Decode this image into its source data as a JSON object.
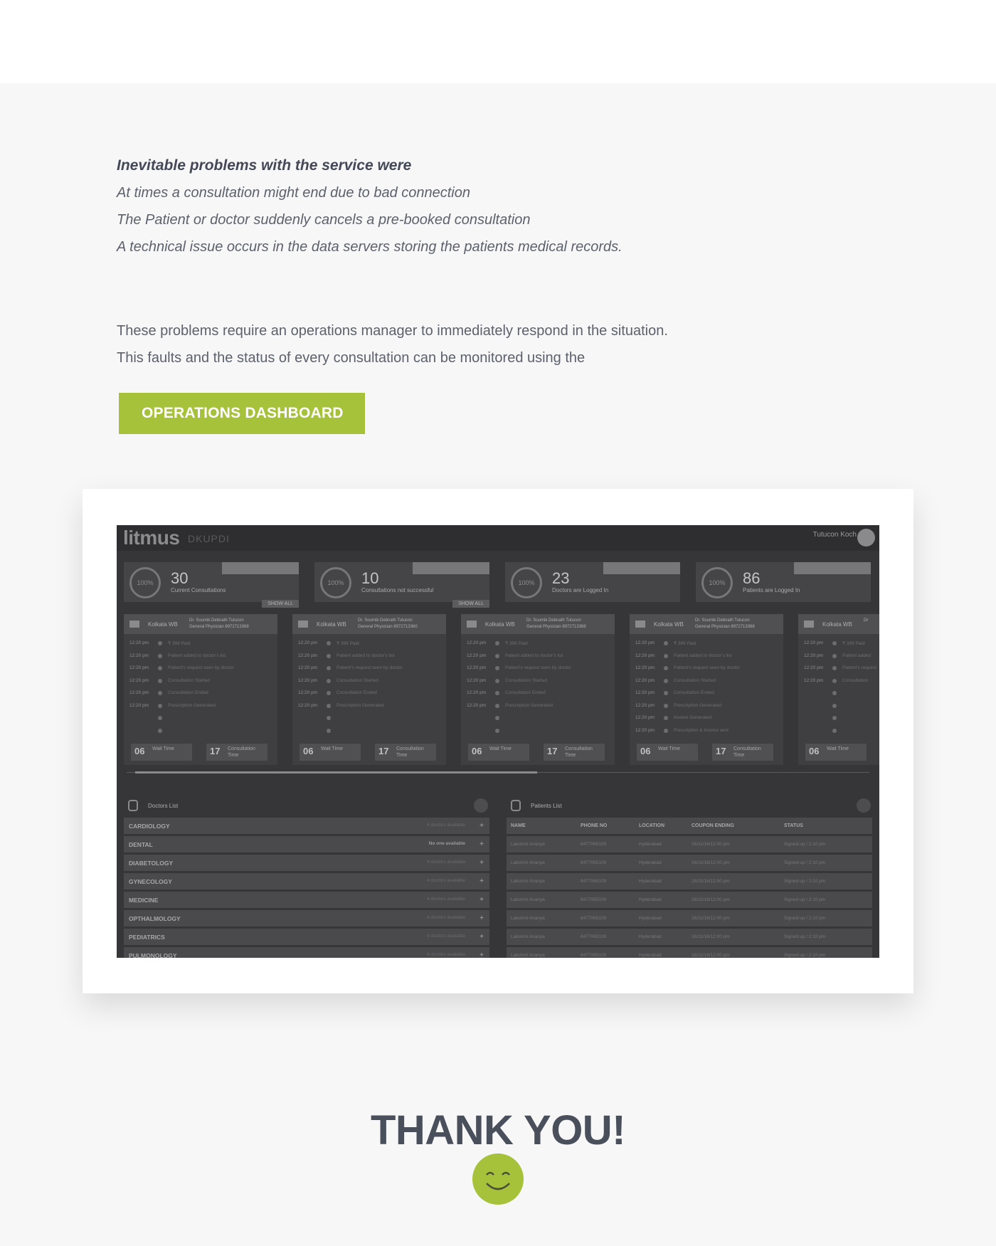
{
  "problems": {
    "heading": "Inevitable problems with the service were",
    "items": [
      "At times a consultation might end due to bad connection",
      "The Patient or doctor suddenly cancels a pre-booked consultation",
      "A technical issue occurs in the data servers storing the patients medical records."
    ]
  },
  "paragraph": [
    "These problems require an operations manager to immediately respond in the situation.",
    "This faults and the status of every consultation can be monitored using the"
  ],
  "cta_label": "OPERATIONS DASHBOARD",
  "dashboard": {
    "logo": "litmus",
    "logo_sub": "DKUPDI",
    "user": "Tutucon Koch",
    "stats": [
      {
        "ring": "100%",
        "value": "30",
        "label": "Current Consultations",
        "show_all": "SHOW ALL"
      },
      {
        "ring": "100%",
        "value": "10",
        "label": "Consultations not successful",
        "show_all": "SHOW ALL"
      },
      {
        "ring": "100%",
        "value": "23",
        "label": "Doctors are Logged In"
      },
      {
        "ring": "100%",
        "value": "86",
        "label": "Patients are Logged In"
      }
    ],
    "columns": [
      {
        "city": "Kolkata WB",
        "doc": "Dr. Soumik Debnath  Tutucon",
        "spec": "General Physician  8972713368",
        "wait": "06",
        "wait_label": "Wait Time",
        "consult": "17",
        "consult_label": "Consultation Time",
        "events": [
          "₹ 399 Paid",
          "Patient added to doctor's list",
          "Patient's request seen by doctor",
          "Consultation Started",
          "Consultation Ended",
          "Prescription Generated"
        ]
      },
      {
        "city": "Kolkata WB",
        "doc": "Dr. Soumik Debnath  Tutucon",
        "spec": "General Physician  8972713360",
        "wait": "06",
        "wait_label": "Wait Time",
        "consult": "17",
        "consult_label": "Consultation Time",
        "events": [
          "₹ 399 Paid",
          "Patient added to doctor's list",
          "Patient's request seen by doctor",
          "Consultation Started",
          "Consultation Ended",
          "Prescription Generated"
        ]
      },
      {
        "city": "Kolkata WB",
        "doc": "Dr. Soumik Debnath  Tutucon",
        "spec": "General Physician  8972713368",
        "wait": "06",
        "wait_label": "Wait Time",
        "consult": "17",
        "consult_label": "Consultation Time",
        "events": [
          "₹ 399 Paid",
          "Patient added to doctor's list",
          "Patient's request seen by doctor",
          "Consultation Started",
          "Consultation Ended",
          "Prescription Generated"
        ]
      },
      {
        "city": "Kolkata WB",
        "doc": "Dr. Soumik Debnath  Tutucon",
        "spec": "General Physician  8972713368",
        "wait": "06",
        "wait_label": "Wait Time",
        "consult": "17",
        "consult_label": "Consultation Time",
        "events": [
          "₹ 399 Paid",
          "Patient added to doctor's list",
          "Patient's request seen by doctor",
          "Consultation Started",
          "Consultation Ended",
          "Prescription Generated",
          "Invoice Generated",
          "Prescription & Invoice sent"
        ]
      },
      {
        "city": "Kolkata WB",
        "doc": "Dr",
        "spec": "",
        "wait": "06",
        "wait_label": "Wait Time",
        "consult": "",
        "consult_label": "",
        "events": [
          "₹ 399 Paid",
          "Patient added",
          "Patient's request",
          "Consultation"
        ]
      }
    ],
    "times": "12:20 pm",
    "doctors_list": {
      "title": "Doctors List",
      "rows": [
        {
          "name": "CARDIOLOGY",
          "avail": "4 doctors available"
        },
        {
          "name": "DENTAL",
          "avail": "No one available"
        },
        {
          "name": "DIABETOLOGY",
          "avail": "4 doctors available"
        },
        {
          "name": "GYNECOLOGY",
          "avail": "4 doctors available"
        },
        {
          "name": "MEDICINE",
          "avail": "4 doctors available"
        },
        {
          "name": "OPTHALMOLOGY",
          "avail": "4 doctors available"
        },
        {
          "name": "PEDIATRICS",
          "avail": "4 doctors available"
        },
        {
          "name": "PULMONOLOGY",
          "avail": "4 doctors available"
        }
      ]
    },
    "patients_list": {
      "title": "Patients List",
      "headers": [
        "NAME",
        "PHONE NO",
        "LOCATION",
        "COUPON ENDING",
        "STATUS"
      ],
      "rows": [
        [
          "Lakshmi Ananya",
          "8477065109",
          "Hyderabad",
          "16/11/16/12:00 pm",
          "Signed up / 2:10 pm"
        ],
        [
          "Lakshmi Ananya",
          "8477065109",
          "Hyderabad",
          "16/11/16/12:00 pm",
          "Signed up / 2:10 pm"
        ],
        [
          "Lakshmi Ananya",
          "8477065109",
          "Hyderabad",
          "16/11/16/12:00 pm",
          "Signed up / 2:10 pm"
        ],
        [
          "Lakshmi Ananya",
          "8477065109",
          "Hyderabad",
          "16/11/16/12:00 pm",
          "Signed up / 2:10 pm"
        ],
        [
          "Lakshmi Ananya",
          "8477065109",
          "Hyderabad",
          "16/11/16/12:00 pm",
          "Signed up / 2:10 pm"
        ],
        [
          "Lakshmi Ananya",
          "8477065109",
          "Hyderabad",
          "16/11/16/12:00 pm",
          "Signed up / 2:10 pm"
        ],
        [
          "Lakshmi Ananya",
          "8477065109",
          "Hyderabad",
          "16/11/16/12:00 pm",
          "Signed up / 2:10 pm"
        ]
      ]
    }
  },
  "thanks": "THANK YOU!",
  "colors": {
    "accent": "#a6c13a",
    "text": "#4a4f5c",
    "dashboard_bg": "#363638"
  },
  "icons": [
    "user-avatar-icon",
    "video-camera-icon",
    "microphone-icon",
    "stethoscope-icon",
    "patient-icon",
    "search-icon",
    "plus-icon",
    "smiley-face-icon"
  ]
}
